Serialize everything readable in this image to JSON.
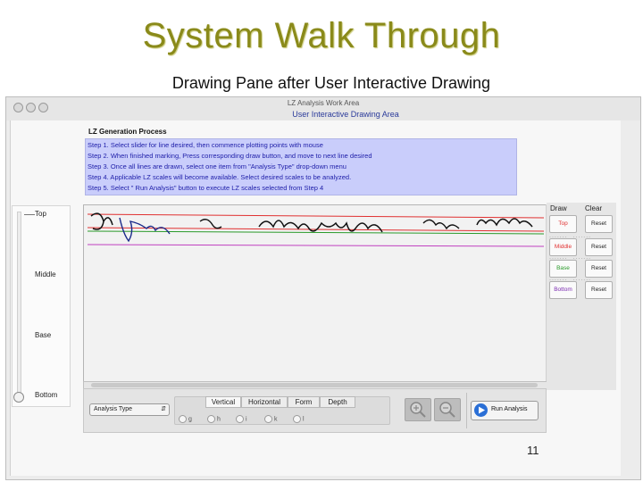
{
  "slide": {
    "title": "System Walk Through",
    "subtitle": "Drawing Pane after User Interactive Drawing",
    "page_number": "11"
  },
  "window": {
    "title": "LZ Analysis Work Area",
    "subtitle": "User Interactive Drawing Area"
  },
  "process": {
    "title": "LZ Generation Process",
    "steps": [
      "Step 1. Select slider for line desired, then commence plotting  points with mouse",
      "Step 2. When finished marking, Press corresponding draw button, and move to next line desired",
      "Step 3. Once all lines are drawn, select one item from \"Analysis Type\" drop-down menu",
      "Step 4. Applicable LZ scales will become available. Select desired scales to be analyzed.",
      "Step 5. Select \" Run Analysis\" button to execute LZ scales selected from Step 4"
    ]
  },
  "slider": {
    "labels": [
      "Top",
      "Middle",
      "Base",
      "Bottom"
    ]
  },
  "draw_panel": {
    "draw_header": "Draw",
    "clear_header": "Clear",
    "draw_buttons": [
      "Top",
      "Middle",
      "Base",
      "Bottom"
    ],
    "clear_buttons": [
      "Reset",
      "Reset",
      "Reset",
      "Reset"
    ],
    "colors": {
      "top": "#e03030",
      "middle": "#e03030",
      "base": "#2a9a2a",
      "bottom": "#7a2ab0"
    }
  },
  "toolbar": {
    "analysis_type_label": "Analysis Type",
    "tabs": [
      "Vertical",
      "Horizontal",
      "Form",
      "Depth"
    ],
    "radio_options": [
      "g",
      "h",
      "i",
      "k",
      "l"
    ],
    "run_label": "Run Analysis"
  }
}
